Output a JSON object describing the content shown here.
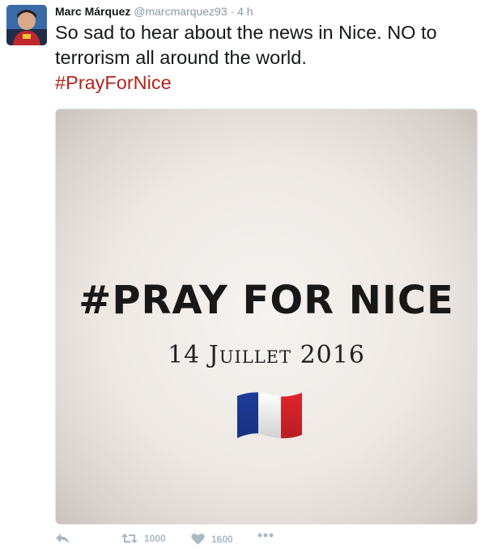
{
  "tweet": {
    "author_name": "Marc Márquez",
    "handle": "@marcmarquez93",
    "separator": "·",
    "time": "4 h",
    "text": "So sad to hear about the news in Nice. NO to terrorism all around the world.",
    "hashtag": "#PrayForNice"
  },
  "media": {
    "title": "#PRAY FOR NICE",
    "date": "14 Juillet 2016",
    "flag_icon": "france-flag-icon",
    "flag_colors": [
      "#1d3d9a",
      "#ffffff",
      "#e0242c"
    ]
  },
  "actions": {
    "reply_icon": "reply-icon",
    "retweet_icon": "retweet-icon",
    "retweet_count": "1000",
    "like_icon": "heart-icon",
    "like_count": "1600",
    "more_icon": "more-icon"
  },
  "colors": {
    "hashtag": "#b0251e",
    "muted": "#8899a6",
    "action": "#aab8c2"
  }
}
